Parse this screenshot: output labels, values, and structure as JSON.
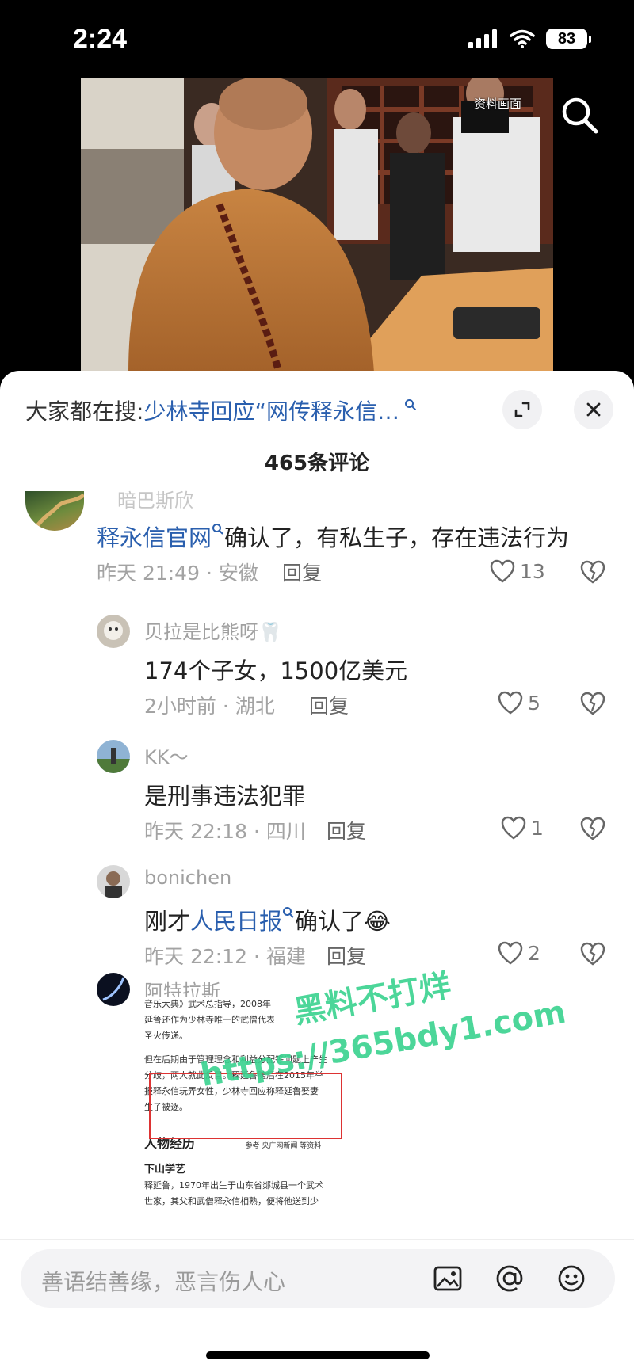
{
  "status_bar": {
    "time": "2:24",
    "battery": "83"
  },
  "video": {
    "badge": "资料画面"
  },
  "sheet": {
    "trending_prefix": "大家都在搜:",
    "trending_query": "少林寺回应“网传释永信…",
    "comment_count": "465条评论"
  },
  "comments": [
    {
      "user": "暗巴斯欣",
      "text_link": "释永信官网",
      "text_rest": "确认了，有私生子，存在违法行为",
      "meta": "昨天 21:49 · 安徽",
      "reply": "回复",
      "likes": "13"
    },
    {
      "user": "贝拉是比熊呀🦷",
      "text": "174个子女，1500亿美元",
      "meta": "2小时前 · 湖北",
      "reply": "回复",
      "likes": "5"
    },
    {
      "user": "KK～",
      "text": "是刑事违法犯罪",
      "meta": "昨天 22:18 · 四川",
      "reply": "回复",
      "likes": "1"
    },
    {
      "user": "bonichen",
      "text_prefix": "刚才",
      "text_link": "人民日报",
      "text_suffix": "确认了😂",
      "meta": "昨天 22:12 · 福建",
      "reply": "回复",
      "likes": "2"
    },
    {
      "user": "阿特拉斯",
      "attachment": {
        "line1": "音乐大典》武术总指导，2008年",
        "line2": "延鲁还作为少林寺唯一的武僧代表",
        "line3": "圣火传递。",
        "line4": "但在后期由于管理理念和利益分配等问题上产生",
        "line5": "分歧，两人就此反目。释延鲁随后在2015年举",
        "line6": "报释永信玩弄女性，少林寺回应称释延鲁娶妻",
        "line7": "生子被逐。",
        "section": "人物经历",
        "section_note": "参考 央广网新闻 等资料",
        "subsection": "下山学艺",
        "line8": "释延鲁，1970年出生于山东省郯城县一个武术",
        "line9": "世家，其父和武僧释永信相熟，便将他送到少"
      },
      "watermark_line1": "黑料不打烊",
      "watermark_line2": "https://365bdy1.com"
    }
  ],
  "input": {
    "placeholder": "善语结善缘，恶言伤人心"
  },
  "icons": [
    "search-icon",
    "expand-icon",
    "close-icon",
    "heart-icon",
    "dislike-icon",
    "image-icon",
    "at-icon",
    "emoji-icon"
  ]
}
